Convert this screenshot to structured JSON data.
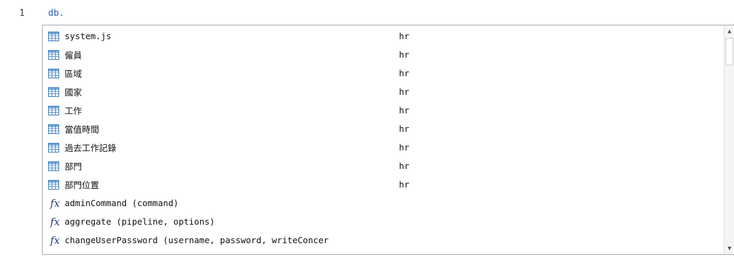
{
  "editor": {
    "line_number": "1",
    "code": "db."
  },
  "autocomplete": {
    "items": [
      {
        "icon": "table-icon",
        "label": "system.js",
        "meta": "hr"
      },
      {
        "icon": "table-icon",
        "label": "僱員",
        "meta": "hr"
      },
      {
        "icon": "table-icon",
        "label": "區域",
        "meta": "hr"
      },
      {
        "icon": "table-icon",
        "label": "國家",
        "meta": "hr"
      },
      {
        "icon": "table-icon",
        "label": "工作",
        "meta": "hr"
      },
      {
        "icon": "table-icon",
        "label": "當值時間",
        "meta": "hr"
      },
      {
        "icon": "table-icon",
        "label": "過去工作記錄",
        "meta": "hr"
      },
      {
        "icon": "table-icon",
        "label": "部門",
        "meta": "hr"
      },
      {
        "icon": "table-icon",
        "label": "部門位置",
        "meta": "hr"
      },
      {
        "icon": "function-icon",
        "label": "adminCommand (command)",
        "meta": ""
      },
      {
        "icon": "function-icon",
        "label": "aggregate (pipeline, options)",
        "meta": ""
      },
      {
        "icon": "function-icon",
        "label": "changeUserPassword (username, password, writeConcer",
        "meta": ""
      }
    ],
    "function_glyph": "fx",
    "colors": {
      "table_icon_border": "#3a7bbf",
      "table_icon_header": "#7fb0e0",
      "function_icon": "#1f3f7a",
      "code_text": "#2a63b8"
    }
  }
}
